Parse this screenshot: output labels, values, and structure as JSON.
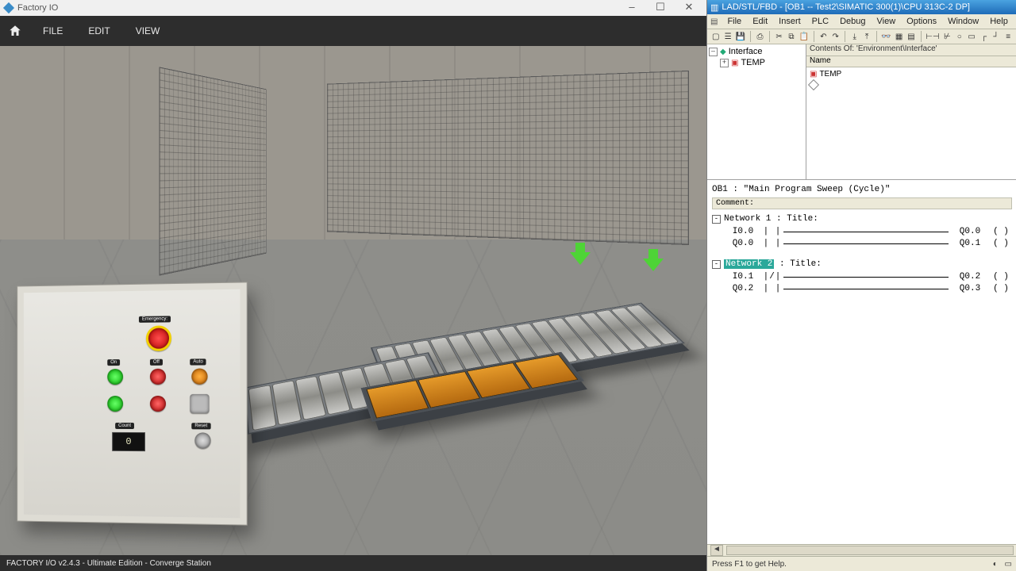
{
  "factoryio": {
    "window_title": "Factory IO",
    "menu": {
      "file": "FILE",
      "edit": "EDIT",
      "view": "VIEW"
    },
    "status": "FACTORY I/O v2.4.3 - Ultimate Edition - Converge Station",
    "cabinet": {
      "emergency_label": "Emergency:",
      "on_label": "On",
      "off_label": "Off",
      "auto_label": "Auto",
      "count_label": "Count",
      "reset_label": "Reset",
      "count_value": "0"
    }
  },
  "plc": {
    "title": "LAD/STL/FBD  - [OB1 -- Test2\\SIMATIC 300(1)\\CPU 313C-2 DP]",
    "menu": {
      "file": "File",
      "edit": "Edit",
      "insert": "Insert",
      "plc": "PLC",
      "debug": "Debug",
      "view": "View",
      "options": "Options",
      "window": "Window",
      "help": "Help"
    },
    "tree": {
      "root": "Interface",
      "item1": "TEMP"
    },
    "contents": {
      "header": "Contents Of: 'Environment\\Interface'",
      "col_name": "Name",
      "row1": "TEMP"
    },
    "ob_title": "OB1 :  \"Main Program Sweep (Cycle)\"",
    "comment_label": "Comment:",
    "networks": [
      {
        "label": "Network 1",
        "title": "Title:",
        "rungs": [
          {
            "in_addr": "I0.0",
            "contact": "| |",
            "out_addr": "Q0.0",
            "coil": "( )"
          },
          {
            "in_addr": "Q0.0",
            "contact": "| |",
            "out_addr": "Q0.1",
            "coil": "( )"
          }
        ]
      },
      {
        "label": "Network 2",
        "title": "Title:",
        "selected": true,
        "rungs": [
          {
            "in_addr": "I0.1",
            "contact": "|/|",
            "out_addr": "Q0.2",
            "coil": "( )"
          },
          {
            "in_addr": "Q0.2",
            "contact": "| |",
            "out_addr": "Q0.3",
            "coil": "( )"
          }
        ]
      }
    ],
    "status": "Press F1 to get Help."
  }
}
